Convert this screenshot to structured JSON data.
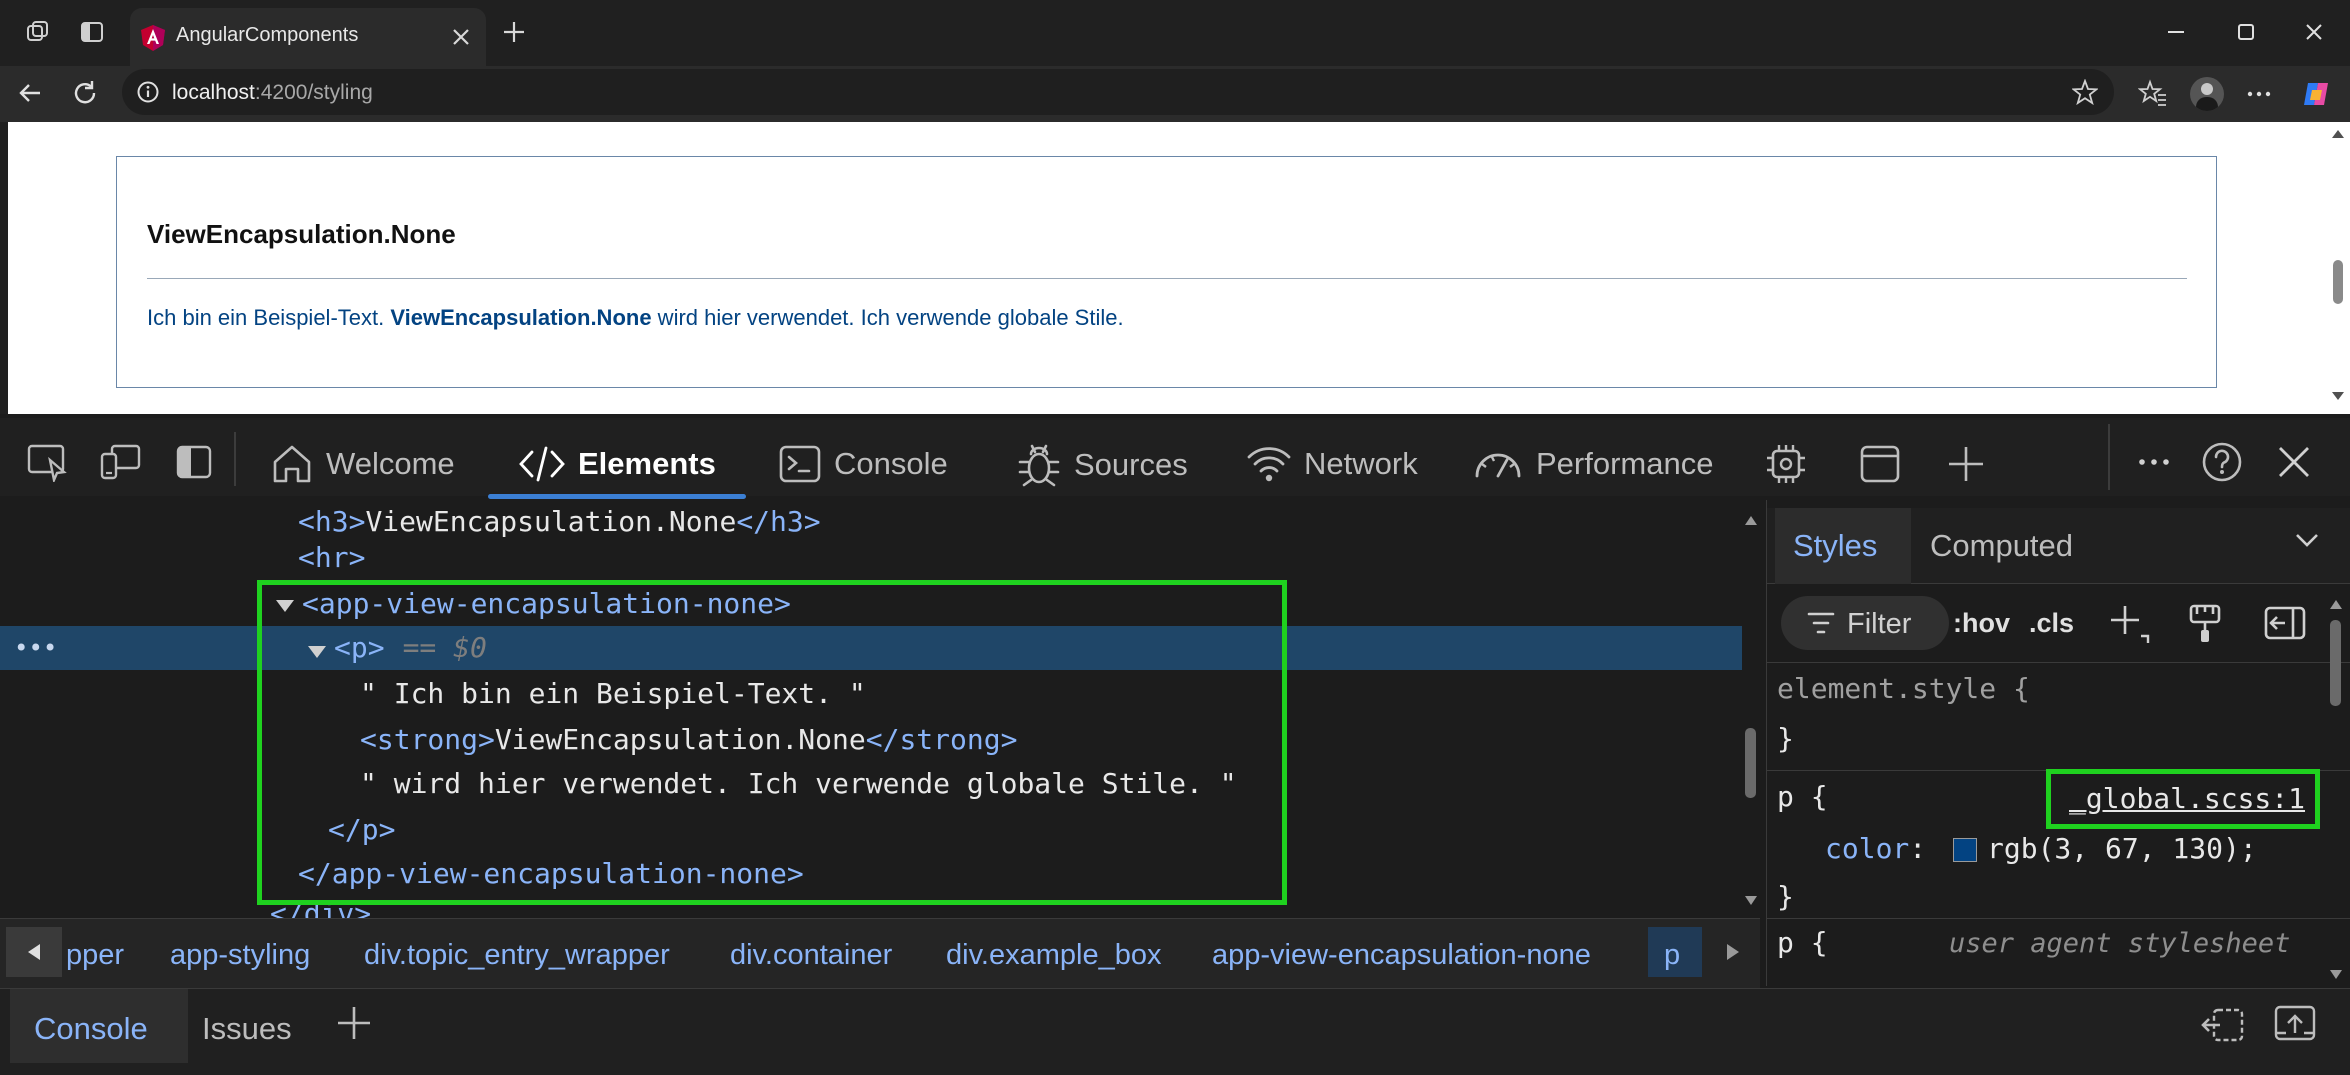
{
  "browser": {
    "tab_title": "AngularComponents",
    "url_host": "localhost",
    "url_path": ":4200/styling"
  },
  "page": {
    "heading": "ViewEncapsulation.None",
    "text_pre": "Ich bin ein Beispiel-Text. ",
    "text_strong": "ViewEncapsulation.None",
    "text_post": " wird hier verwendet. Ich verwende globale Stile."
  },
  "devtools": {
    "tabs": [
      "Welcome",
      "Elements",
      "Console",
      "Sources",
      "Network",
      "Performance"
    ],
    "active_tab": "Elements",
    "tree": {
      "h3_open": "<h3>",
      "h3_text": "ViewEncapsulation.None",
      "h3_close": "</h3>",
      "hr": "<hr>",
      "app_open": "<app-view-encapsulation-none>",
      "p_open": "<p>",
      "dollar_ref": "== $0",
      "text1": "\" Ich bin ein Beispiel-Text. \"",
      "strong_open": "<strong>",
      "strong_text": "ViewEncapsulation.None",
      "strong_close": "</strong>",
      "text2": "\" wird hier verwendet. Ich verwende globale Stile. \"",
      "p_close": "</p>",
      "app_close": "</app-view-encapsulation-none>",
      "div_close": "</div>",
      "row_menu": "•••"
    },
    "breadcrumbs": [
      "pper",
      "app-styling",
      "div.topic_entry_wrapper",
      "div.container",
      "div.example_box",
      "app-view-encapsulation-none",
      "p"
    ],
    "styles_pane": {
      "tabs": [
        "Styles",
        "Computed"
      ],
      "filter_label": "Filter",
      "hov": ":hov",
      "cls": ".cls",
      "element_style": "element.style {",
      "close_brace": "}",
      "rule1_selector": "p {",
      "rule1_source": "_global.scss:1",
      "rule1_prop": "color",
      "rule1_value": "rgb(3, 67, 130);",
      "rule1_swatch": "#034382",
      "rule2_selector": "p {",
      "rule2_source": "user agent stylesheet"
    },
    "drawer": {
      "tabs": [
        "Console",
        "Issues"
      ]
    }
  },
  "colors": {
    "highlight": "#1fd11f",
    "selection": "#1f4668",
    "accent": "#3b7fd4",
    "page_text": "#034382"
  }
}
